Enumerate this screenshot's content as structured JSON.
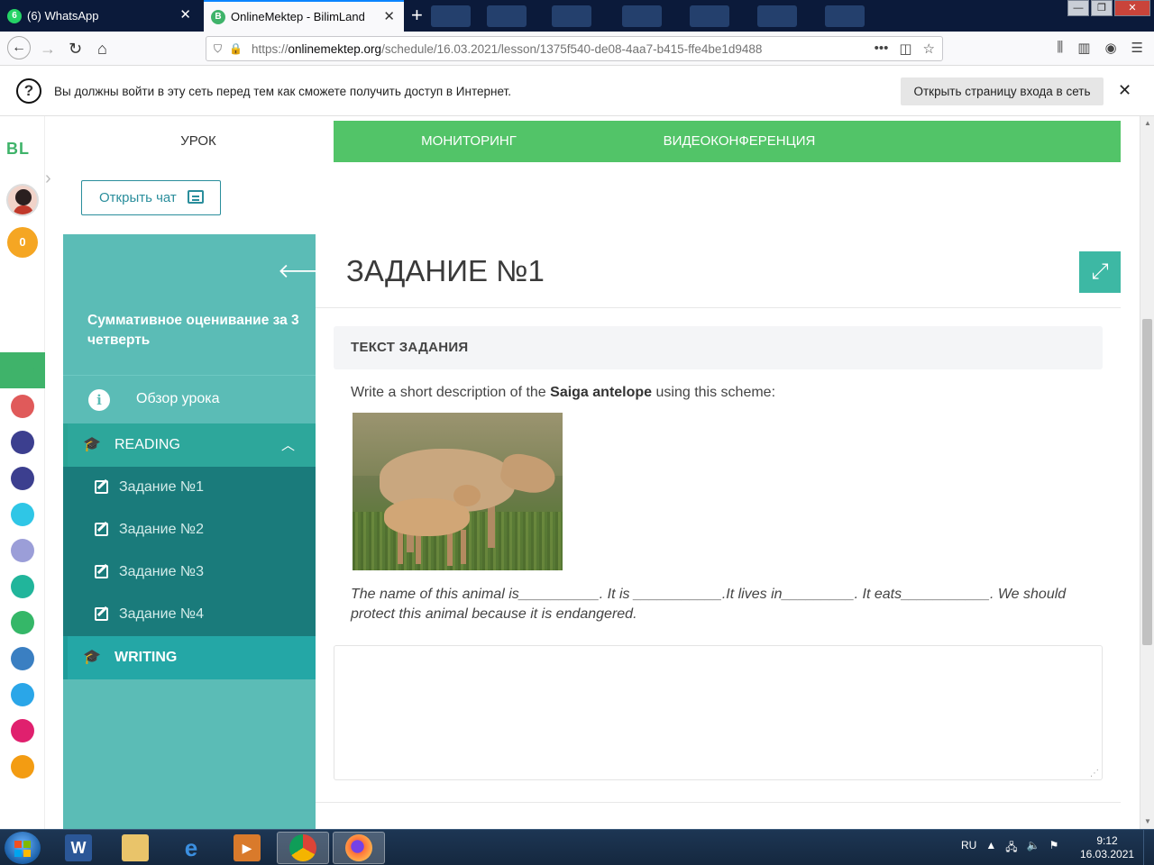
{
  "browser": {
    "tabs": [
      {
        "label": "(6) WhatsApp",
        "favicon": "6"
      },
      {
        "label": "OnlineMektep - BilimLand",
        "favicon": "B"
      }
    ],
    "url_prefix": "https://",
    "url_domain": "onlinemektep.org",
    "url_path": "/schedule/16.03.2021/lesson/1375f540-de08-4aa7-b415-ffe4be1d9488"
  },
  "notice": {
    "message": "Вы должны войти в эту сеть перед тем как сможете получить доступ в Интернет.",
    "button": "Открыть страницу входа в сеть"
  },
  "rail": {
    "logo": "BL",
    "points": "0",
    "apps": [
      {
        "name": "online-mektep",
        "color": "#3fb36a"
      },
      {
        "name": "ustaz",
        "color": "#e05a5a"
      },
      {
        "name": "smart-nation-1",
        "color": "#3c3f8f"
      },
      {
        "name": "smart-nation-2",
        "color": "#3c3f8f"
      },
      {
        "name": "help",
        "color": "#2fc6e6"
      },
      {
        "name": "keyboard",
        "color": "#9b9ed8"
      },
      {
        "name": "bilim-media",
        "color": "#21b59b"
      },
      {
        "name": "bilimland",
        "color": "#35b768"
      },
      {
        "name": "bilim-book",
        "color": "#3a7fc2"
      },
      {
        "name": "tests",
        "color": "#2aa6e8"
      },
      {
        "name": "twig",
        "color": "#e0206e"
      },
      {
        "name": "bilimgo",
        "color": "#f39c12"
      }
    ]
  },
  "top_tabs": [
    {
      "label": "УРОК"
    },
    {
      "label": "МОНИТОРИНГ"
    },
    {
      "label": "ВИДЕОКОНФЕРЕНЦИЯ"
    }
  ],
  "chat_button": "Открыть чат",
  "sidebar": {
    "title": "Суммативное оценивание за 3 четверть",
    "overview": "Обзор урока",
    "section_reading": "READING",
    "tasks": [
      {
        "label": "Задание №1"
      },
      {
        "label": "Задание №2"
      },
      {
        "label": "Задание №3"
      },
      {
        "label": "Задание №4"
      }
    ],
    "section_writing": "WRITING"
  },
  "main": {
    "title": "ЗАДАНИЕ №1",
    "task_text_header": "ТЕКСТ ЗАДАНИЯ",
    "prompt_before": "Write a short description of the ",
    "prompt_bold": "Saiga antelope",
    "prompt_after": " using this scheme:",
    "scheme_text": "The name of this animal is__________. It is ___________.It lives in_________. It eats___________. We should protect this animal because it is endangered.",
    "answer_value": ""
  },
  "taskbar": {
    "language": "RU",
    "time": "9:12",
    "date": "16.03.2021"
  }
}
